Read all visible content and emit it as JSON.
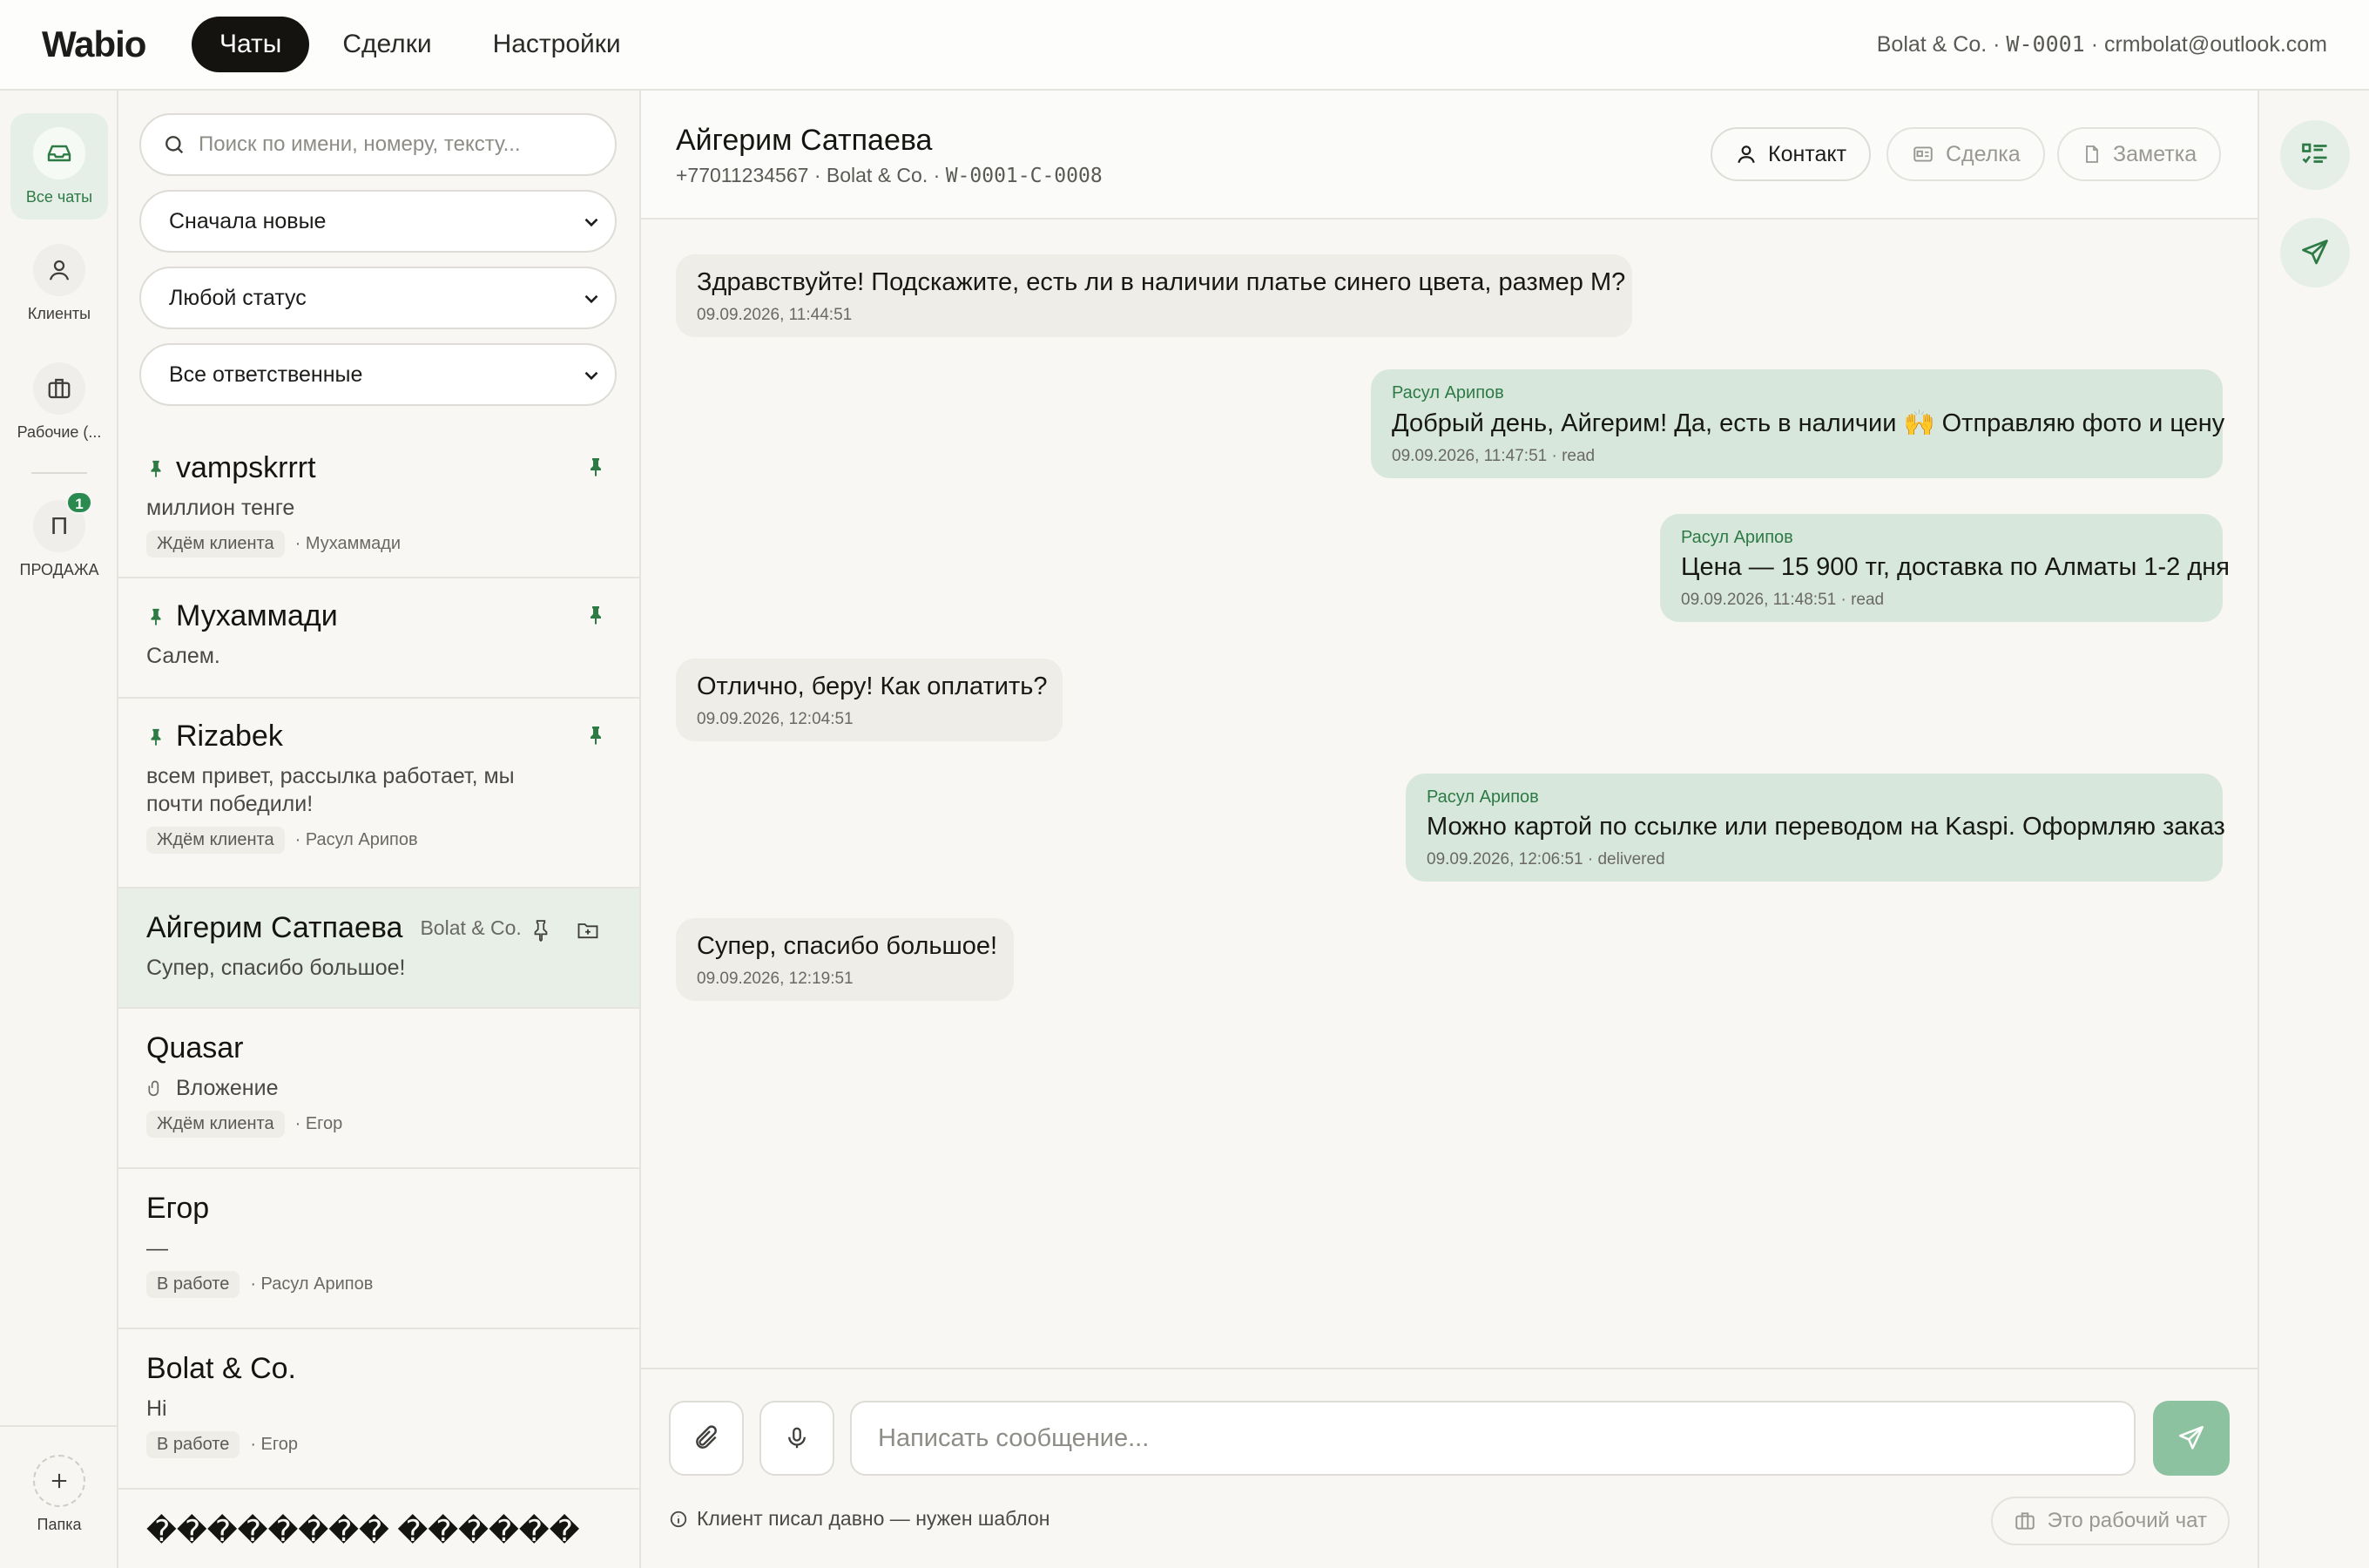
{
  "app": {
    "logo": "Wabio"
  },
  "nav": {
    "tabs": [
      {
        "label": "Чаты",
        "active": true
      },
      {
        "label": "Сделки"
      },
      {
        "label": "Настройки"
      }
    ]
  },
  "account": {
    "company": "Bolat & Co.",
    "workspace_id": "W-0001",
    "email": "crmbolat@outlook.com",
    "sep": "·"
  },
  "rail": {
    "items": [
      {
        "label": "Все чаты",
        "icon": "inbox-icon",
        "active": true
      },
      {
        "label": "Клиенты",
        "icon": "user-icon"
      },
      {
        "label": "Рабочие (...",
        "icon": "briefcase-icon"
      }
    ],
    "folder": {
      "letter": "П",
      "label": "ПРОДАЖА",
      "badge": "1"
    },
    "add_folder": {
      "label": "Папка",
      "icon": "plus-icon"
    }
  },
  "list": {
    "search_placeholder": "Поиск по имени, номеру, тексту...",
    "filters": {
      "sort": "Сначала новые",
      "status": "Любой статус",
      "assignee": "Все ответственные"
    },
    "items": [
      {
        "name": "vampskrrrt",
        "preview": "миллион тенге",
        "status": "Ждём клиента",
        "assignee": "· Мухаммади",
        "pinned": true
      },
      {
        "name": "Мухаммади",
        "preview": "Салем.",
        "pinned": true
      },
      {
        "name": "Rizabek",
        "preview": "всем привет, рассылка работает, мы почти победили!",
        "status": "Ждём клиента",
        "assignee": "· Расул Арипов",
        "pinned": true
      },
      {
        "name": "Айгерим Сатпаева",
        "company": "Bolat & Co.",
        "preview": "Супер, спасибо большое!",
        "active": true
      },
      {
        "name": "Quasar",
        "preview": "Вложение",
        "preview_icon": "paperclip-icon",
        "status": "Ждём клиента",
        "assignee": "· Егор"
      },
      {
        "name": "Егор",
        "preview": "—",
        "status": "В работе",
        "assignee": "· Расул Арипов"
      },
      {
        "name": "Bolat & Co.",
        "preview": "Hi",
        "status": "В работе",
        "assignee": "· Егор"
      },
      {
        "name": "�������� ������"
      }
    ]
  },
  "chat": {
    "title": "Айгерим Сатпаева",
    "phone": "+77011234567",
    "company": "Bolat & Co.",
    "chat_id": "W-0001-C-0008",
    "buttons": {
      "contact": "Контакт",
      "deal": "Сделка",
      "note": "Заметка"
    },
    "messages": [
      {
        "dir": "in",
        "text": "Здравствуйте! Подскажите, есть ли в наличии платье синего цвета, размер M?",
        "time": "09.09.2026, 11:44:51"
      },
      {
        "dir": "out",
        "author": "Расул Арипов",
        "text": "Добрый день, Айгерим! Да, есть в наличии 🙌 Отправляю фото и цену",
        "time": "09.09.2026, 11:47:51 · read"
      },
      {
        "dir": "out",
        "author": "Расул Арипов",
        "text": "Цена — 15 900 тг, доставка по Алматы 1-2 дня",
        "time": "09.09.2026, 11:48:51 · read"
      },
      {
        "dir": "in",
        "text": "Отлично, беру! Как оплатить?",
        "time": "09.09.2026, 12:04:51"
      },
      {
        "dir": "out",
        "author": "Расул Арипов",
        "text": "Можно картой по ссылке или переводом на Kaspi. Оформляю заказ",
        "time": "09.09.2026, 12:06:51 · delivered"
      },
      {
        "dir": "in",
        "text": "Супер, спасибо большое!",
        "time": "09.09.2026, 12:19:51"
      }
    ],
    "composer": {
      "placeholder": "Написать сообщение...",
      "hint": "Клиент писал давно — нужен шаблон",
      "work_chat": "Это рабочий чат"
    }
  },
  "right_rail": {
    "icons": [
      "checklist-icon",
      "send-icon"
    ]
  },
  "colors": {
    "accent": "#2d7a45",
    "active_bg": "#e7efe6",
    "out_bubble": "#d7e7dc",
    "in_bubble": "#eeede8",
    "send": "#8cc29f"
  }
}
